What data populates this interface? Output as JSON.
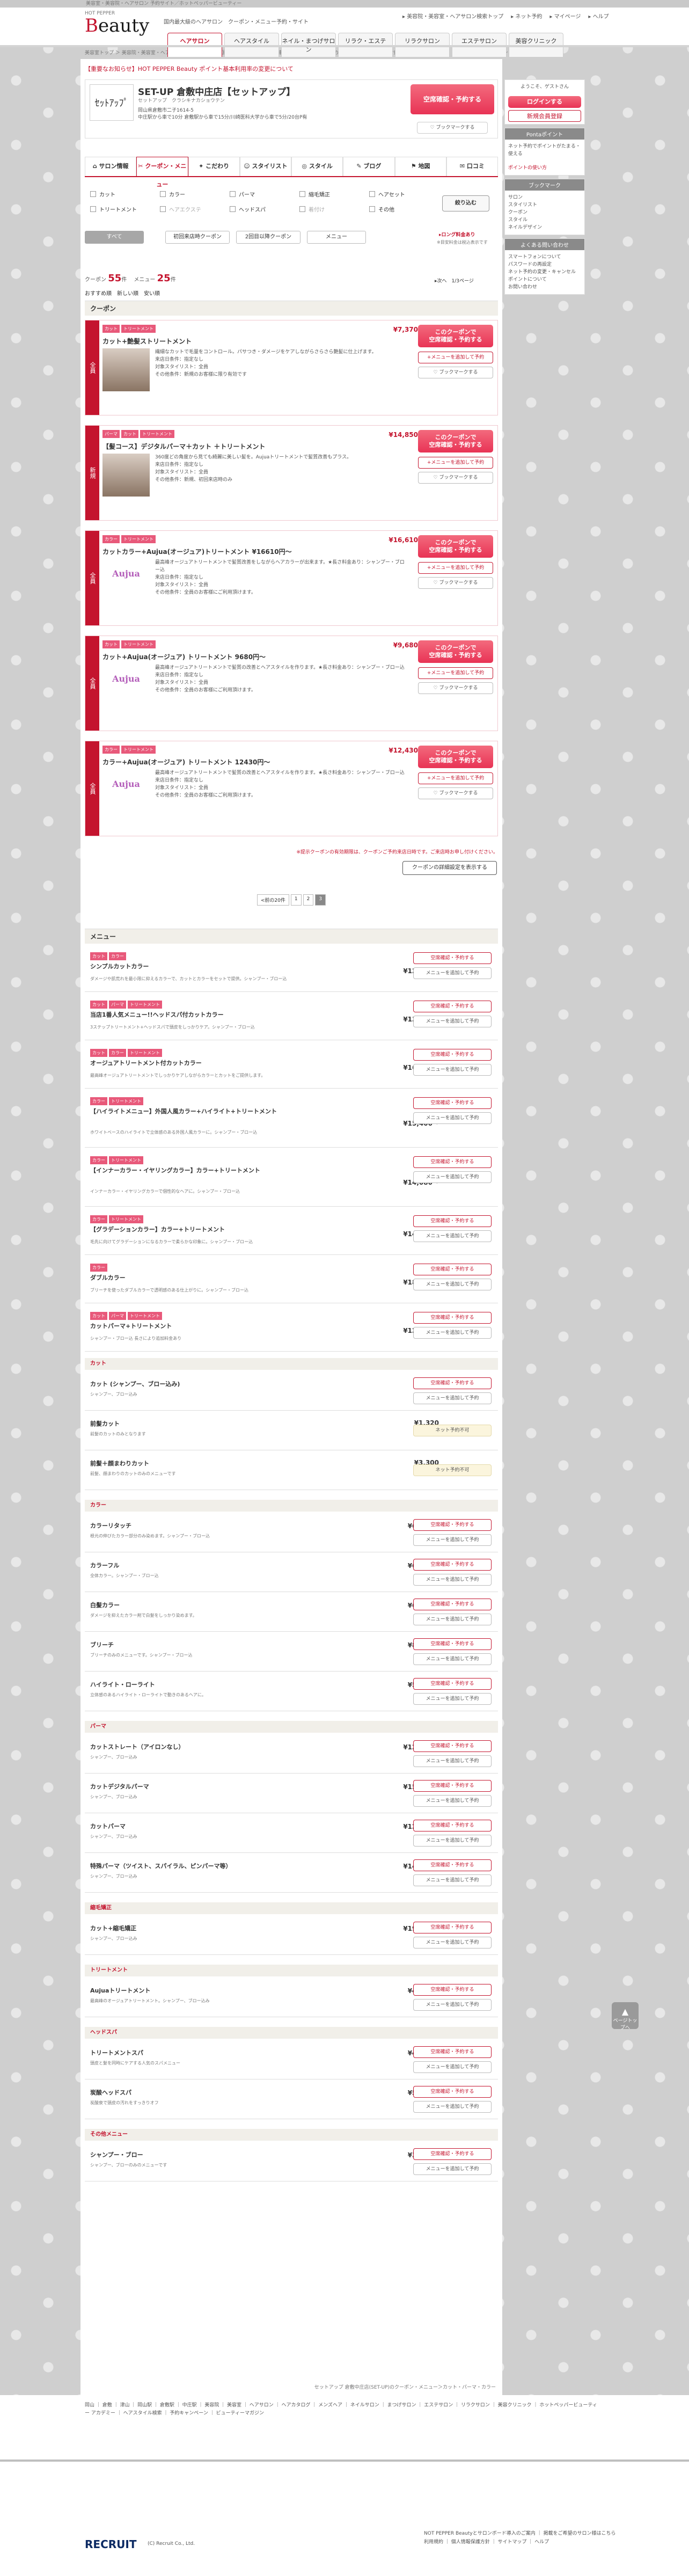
{
  "top": {
    "strip": "美容室・美容院・ヘアサロン 予約サイト／ホットペッパービューティー",
    "logo_small": "HOT PEPPER",
    "logo_b": "B",
    "logo_rest": "eauty",
    "tagline": "国内最大級のヘアサロン",
    "tagline2": "クーポン・メニュー予約・サイト",
    "util": [
      "▸ 美容院・美容室・ヘアサロン検索トップ",
      "▸ ネット予約",
      "▸ マイページ",
      "▸ ヘルプ"
    ],
    "nav": [
      "ヘアサロン",
      "ヘアスタイル",
      "ネイル・まつげサロン",
      "リラク・エステ",
      "リラクサロン",
      "エステサロン",
      "美容クリニック"
    ]
  },
  "crumb": "美容室トップ ＞ 美容院・美容室・ヘアサロン検索トップ ＞ 中国トップ ＞ 岡山・倉敷・津山トップ ＞ 倉敷駅周辺のヘアサロン ＞ SET-UP 倉敷中庄店【セットアップ】のサロン情報 ＞ クーポン・メニュー ＞ 前ページ",
  "notice": "【重要なお知らせ】HOT PEPPER Beauty ポイント基本利用率の変更について",
  "salon": {
    "thumb": "ｾｯﾄｱｯﾌﾟ",
    "name": "SET-UP 倉敷中庄店【セットアップ】",
    "kana": "セットアップ　クラシキナカショウテン",
    "desc": "岡山県倉敷市二子1614-5\n中庄駅から車で10分 倉敷駅から車で15分/川崎医科大学から車で5分/20台P有",
    "reserve": "空席確認・予約する",
    "bookmark": "ブックマークする"
  },
  "tabs": [
    "サロン情報",
    "クーポン・メニュー",
    "こだわり",
    "スタイリスト",
    "スタイル",
    "ブログ",
    "地図",
    "口コミ"
  ],
  "filters": [
    "カット",
    "カラー",
    "パーマ",
    "縮毛矯正",
    "ヘアセット",
    "トリートメント",
    "ヘアエクステ",
    "ヘッドスパ",
    "着付け",
    "その他"
  ],
  "filter_btn": "絞り込む",
  "segs": [
    "すべて",
    "初回来店時クーポン",
    "2回目以降クーポン",
    "メニュー"
  ],
  "seg_note": "▸ロング料金あり",
  "seg_note2": "※目安料金は税込表示です",
  "counts": {
    "coupon_label": "クーポン",
    "coupon": "55",
    "coupon_unit": "件",
    "menu_label": "メニュー",
    "menu": "25",
    "menu_unit": "件",
    "pages": "1/3ページ",
    "next": "▸次へ"
  },
  "order": "おすすめ順　新しい順　安い順",
  "coupon_head": "クーポン",
  "coupons": [
    {
      "side": "全員",
      "tags": [
        "カット",
        "トリートメント"
      ],
      "price": "¥7,370",
      "title": "カット+艶髪ストリートメント",
      "photo": true,
      "desc": "繊細なカットで毛量をコントロール。パサつき・ダメージをケアしながらさらさら艶髪に仕上げます。\n来店日条件：指定なし\n対象スタイリスト：全員\nその他条件：新規のお客様に限り有効です"
    },
    {
      "side": "新規",
      "tags": [
        "パーマ",
        "カット",
        "トリートメント"
      ],
      "price": "¥14,850",
      "title": "【髪コース】デジタルパーマ＋カット ＋トリートメント",
      "photo": true,
      "desc": "360度どの角度から見ても綺麗に美しい髪を。Aujuaトリートメントで髪質改善もプラス。\n来店日条件：指定なし\n対象スタイリスト：全員\nその他条件：新規、初回来店時のみ"
    },
    {
      "side": "全員",
      "tags": [
        "カラー",
        "トリートメント"
      ],
      "price": "¥16,610",
      "title": "カットカラー+Aujua(オージュア)トリートメント ¥16610円～",
      "photo": false,
      "desc": "最高峰オージュアトリートメントで髪質改善をしながらヘアカラーが出来ます。★長さ料金あり：シャンプー・ブロー込\n来店日条件：指定なし\n対象スタイリスト：全員\nその他条件：全員のお客様にご利用頂けます。"
    },
    {
      "side": "全員",
      "tags": [
        "カット",
        "トリートメント"
      ],
      "price": "¥9,680",
      "title": "カット+Aujua(オージュア) トリートメント 9680円～",
      "photo": false,
      "desc": "最高峰オージュアトリートメントで髪質の改善とヘアスタイルを作ります。★長さ料金あり：シャンプー・ブロー込\n来店日条件：指定なし\n対象スタイリスト：全員\nその他条件：全員のお客様にご利用頂けます。"
    },
    {
      "side": "全員",
      "tags": [
        "カラー",
        "トリートメント"
      ],
      "price": "¥12,430",
      "title": "カラー+Aujua(オージュア) トリートメント 12430円～",
      "photo": false,
      "desc": "最高峰オージュアトリートメントで髪質の改善とヘアスタイルを作ります。★長さ料金あり：シャンプー・ブロー込\n来店日条件：指定なし\n対象スタイリスト：全員\nその他条件：全員のお客様にご利用頂けます。"
    }
  ],
  "coupon_btns": {
    "reserve": "このクーポンで\n空席確認・予約する",
    "menu_add": "+メニューを追加して予約",
    "bookmark": "ブックマークする"
  },
  "coupon_note": "※提示クーポンの有効期限は、クーポンご予約来店日時です。ご来店時お申し付けください。",
  "coupon_more": "クーポンの詳細設定を表示する",
  "pager": [
    "<前の20件",
    "1",
    "2",
    "3"
  ],
  "menu_head": "メニュー",
  "menus": [
    {
      "tags": [
        "カット",
        "カラー"
      ],
      "title": "シンプルカットカラー",
      "price": "¥12,760～",
      "desc": "ダメージや肌荒れを最小限に抑えるカラーで、カットとカラーをセットで提供。シャンプー・ブロー込"
    },
    {
      "tags": [
        "カット",
        "パーマ",
        "トリートメント"
      ],
      "title": "当店1番人気メニュー!!ヘッドスパ付カットカラー",
      "price": "¥13,090～",
      "desc": "3ステップトリートメント+ヘッドスパで頭皮をしっかりケア。シャンプー・ブロー込"
    },
    {
      "tags": [
        "カット",
        "カラー",
        "トリートメント"
      ],
      "title": "オージュアトリートメント付カットカラー",
      "price": "¥16,610～",
      "desc": "最高峰オージュアトリートメントでしっかりケアしながらカラーとカットをご提供します。"
    },
    {
      "tags": [
        "カラー",
        "トリートメント"
      ],
      "title": "【ハイライトメニュー】外国人風カラー+ハイライト+トリートメント",
      "price": "¥15,400～",
      "desc": "ホワイトベースのハイライトで立体感のある外国人風カラーに。シャンプー・ブロー込"
    },
    {
      "tags": [
        "カラー",
        "トリートメント"
      ],
      "title": "【インナーカラー・イヤリングカラー】カラー+トリートメント",
      "price": "¥14,080～",
      "desc": "インナーカラー・イヤリングカラーで個性的なヘアに。シャンプー・ブロー込"
    },
    {
      "tags": [
        "カラー",
        "トリートメント"
      ],
      "title": "【グラデーションカラー】カラー+トリートメント",
      "price": "¥14,630～",
      "desc": "毛先に向けてグラデーションになるカラーで柔らかな印象に。シャンプー・ブロー込"
    },
    {
      "tags": [
        "カラー"
      ],
      "title": "ダブルカラー",
      "price": "¥18,150～",
      "desc": "ブリーチを使ったダブルカラーで透明感のある仕上がりに。シャンプー・ブロー込"
    },
    {
      "tags": [
        "カット",
        "パーマ",
        "トリートメント"
      ],
      "title": "カットパーマ+トリートメント",
      "price": "¥12,430～",
      "desc": "シャンプー・ブロー込 長さにより追加料金あり"
    }
  ],
  "menu_btns": {
    "reserve": "空席確認・予約する",
    "add": "メニューを追加して予約",
    "na": "ネット予約不可"
  },
  "subs": [
    {
      "name": "カット",
      "items": [
        {
          "title": "カット (シャンプー、ブロー込み)",
          "price": "¥5,500",
          "desc": "シャンプー、ブロー込み",
          "na": false
        },
        {
          "title": "前髪カット",
          "price": "¥1,320",
          "desc": "前髪のカットのみとなります",
          "na": true
        },
        {
          "title": "前髪＋顔まわりカット",
          "price": "¥3,300",
          "desc": "前髪、顔まわりのカットのみのメニューです",
          "na": true
        }
      ]
    },
    {
      "name": "カラー",
      "items": [
        {
          "title": "カラーリタッチ",
          "price": "¥6,380～",
          "desc": "根元の伸びたカラー部分のみ染めます。シャンプー・ブロー込",
          "na": false
        },
        {
          "title": "カラーフル",
          "price": "¥6,930～",
          "desc": "全体カラー。シャンプー・ブロー込",
          "na": false
        },
        {
          "title": "白髪カラー",
          "price": "¥6,600～",
          "desc": "ダメージを抑えたカラー剤で白髪をしっかり染めます。",
          "na": false
        },
        {
          "title": "ブリーチ",
          "price": "¥8,250～",
          "desc": "ブリーチのみのメニューです。シャンプー・ブロー込",
          "na": false
        },
        {
          "title": "ハイライト・ローライト",
          "price": "¥5,500～",
          "desc": "立体感のあるハイライト・ローライトで動きのあるヘアに。",
          "na": false
        }
      ]
    },
    {
      "name": "パーマ",
      "items": [
        {
          "title": "カットストレート（アイロンなし）",
          "price": "¥12,650～",
          "desc": "シャンプー、ブロー込み",
          "na": false
        },
        {
          "title": "カットデジタルパーマ",
          "price": "¥15,400～",
          "desc": "シャンプー、ブロー込み",
          "na": false
        },
        {
          "title": "カットパーマ",
          "price": "¥12,430～",
          "desc": "シャンプー、ブロー込み",
          "na": false
        },
        {
          "title": "特殊パーマ（ツイスト、スパイラル、ピンパーマ等）",
          "price": "¥14,630～",
          "desc": "シャンプー、ブロー込み",
          "na": false
        }
      ]
    },
    {
      "name": "縮毛矯正",
      "items": [
        {
          "title": "カット+縮毛矯正",
          "price": "¥19,250～",
          "desc": "シャンプー、ブロー込み",
          "na": false
        }
      ]
    },
    {
      "name": "トリートメント",
      "items": [
        {
          "title": "Aujuaトリートメント",
          "price": "¥4,180～",
          "desc": "最高峰のオージュアトリートメント。シャンプー、ブロー込み",
          "na": false
        }
      ]
    },
    {
      "name": "ヘッドスパ",
      "items": [
        {
          "title": "トリートメントスパ",
          "price": "¥4,950～",
          "desc": "頭皮と髪を同時にケアする人気のスパメニュー",
          "na": false
        },
        {
          "title": "炭酸ヘッドスパ",
          "price": "¥5,500～",
          "desc": "炭酸泉で頭皮の汚れをすっきりオフ",
          "na": false
        }
      ]
    },
    {
      "name": "その他メニュー",
      "items": [
        {
          "title": "シャンプー・ブロー",
          "price": "¥3,630～",
          "desc": "シャンプー、ブローのみのメニューです",
          "na": false
        }
      ]
    }
  ],
  "endcrumb": "セットアップ 倉敷中庄店(SET-UP)のクーポン・メニュー＞カット・パーマ・カラー",
  "side": {
    "welcome": "ようこそ、ゲストさん",
    "login": "ログインする",
    "signup": "新規会員登録",
    "point_title": "Pontaポイント",
    "point_body": "ネット予約でポイントがたまる・使える",
    "ponta": "ポイントの使い方",
    "bm_title": "ブックマーク",
    "bm_items": [
      "サロン",
      "スタイリスト",
      "クーポン",
      "スタイル",
      "ネイルデザイン"
    ],
    "faq_title": "よくある問い合わせ",
    "faq": [
      "スマートフォンについて",
      "パスワードの再設定",
      "ネット予約の変更・キャンセル",
      "ポイントについて",
      "お問い合わせ"
    ]
  },
  "footer": {
    "links": "岡山 ｜ 倉敷 ｜ 津山 ｜ 岡山駅 ｜ 倉敷駅 ｜ 中庄駅 ｜ 美容院 ｜ 美容室 ｜ ヘアサロン ｜ ヘアカタログ ｜ メンズヘア ｜ ネイルサロン ｜ まつげサロン ｜ エステサロン ｜ リラクサロン ｜ 美容クリニック ｜ ホットペッパービューティー アカデミー ｜ ヘアスタイル検索 ｜ 予約キャンペーン ｜ ビューティーマガジン",
    "rec": "RECRUIT",
    "copy": "(C) Recruit Co., Ltd.",
    "rlinks": "NOT PEPPER Beautyとサロンボード導入のご案内 ｜ 掲載をご希望のサロン様はこちら\n利用規約 ｜ 個人情報保護方針 ｜ サイトマップ ｜ ヘルプ"
  },
  "totop": "ページトップへ"
}
